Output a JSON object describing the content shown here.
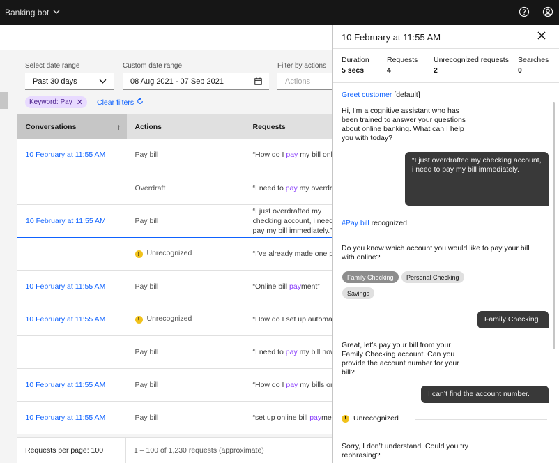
{
  "app": {
    "title": "Banking bot"
  },
  "filters": {
    "date_range_label": "Select date range",
    "date_range_value": "Past 30 days",
    "custom_range_label": "Custom date range",
    "custom_range_value": "08 Aug 2021 - 07 Sep 2021",
    "actions_label": "Filter by actions",
    "actions_placeholder": "Actions",
    "keyword_tag": "Keyword: Pay",
    "clear_filters": "Clear filters"
  },
  "table": {
    "columns": [
      "Conversations",
      "Actions",
      "Requests"
    ],
    "rows": [
      {
        "conversation": "10 February at 11:55 AM",
        "action": "Pay bill",
        "warn": false,
        "req_pre": "“How do I ",
        "req_kw": "pay",
        "req_post": " my bill online?”"
      },
      {
        "conversation": "",
        "action": "Overdraft",
        "warn": false,
        "req_pre": "“I need to ",
        "req_kw": "pay",
        "req_post": " my overdraft fee”"
      },
      {
        "conversation": "10 February at 11:55 AM",
        "action": "Pay bill",
        "warn": false,
        "req_pre": "“I just overdrafted my checking account, i need to pay my bill immediately.”",
        "req_kw": "",
        "req_post": ""
      },
      {
        "conversation": "",
        "action": "Unrecognized",
        "warn": true,
        "req_pre": "“I’ve already made one payment”",
        "req_kw": "",
        "req_post": ""
      },
      {
        "conversation": "10 February at 11:55 AM",
        "action": "Pay bill",
        "warn": false,
        "req_pre": "“Online bill ",
        "req_kw": "pay",
        "req_post": "ment”"
      },
      {
        "conversation": "10 February at 11:55 AM",
        "action": "Unrecognized",
        "warn": true,
        "req_pre": "“How do I set up automatic payments”",
        "req_kw": "",
        "req_post": ""
      },
      {
        "conversation": "",
        "action": "Pay bill",
        "warn": false,
        "req_pre": "“I need to ",
        "req_kw": "pay",
        "req_post": " my bill now”"
      },
      {
        "conversation": "10 February at 11:55 AM",
        "action": "Pay bill",
        "warn": false,
        "req_pre": "“How do I ",
        "req_kw": "pay",
        "req_post": " my bills online”"
      },
      {
        "conversation": "10 February at 11:55 AM",
        "action": "Pay bill",
        "warn": false,
        "req_pre": "“set up online bill ",
        "req_kw": "pay",
        "req_post": "ment”"
      }
    ]
  },
  "footer": {
    "per_page": "Requests per page:  100",
    "range": "1 – 100 of 1,230 requests (approximate)"
  },
  "panel": {
    "title": "10 February at 11:55 AM",
    "stats": [
      {
        "label": "Duration",
        "value": "5 secs"
      },
      {
        "label": "Requests",
        "value": "4"
      },
      {
        "label": "Unrecognized requests",
        "value": "2"
      },
      {
        "label": "Searches",
        "value": "0"
      }
    ],
    "greet_link": "Greet customer",
    "greet_suffix": " [default]",
    "bot_msg_1": "Hi, I'm a cognitive assistant who has been trained to answer your questions about online banking. What can I help you with today?",
    "user_msg_1": "“I just overdrafted my checking account, i need to pay my bill immediately.",
    "intent_link": "#Pay bill",
    "intent_suffix": " recognized",
    "bot_msg_2": "Do you know which account you would like to pay your bill with online?",
    "options": [
      "Family Checking",
      "Personal Checking",
      "Savings"
    ],
    "user_msg_2": "Family Checking",
    "bot_msg_3": "Great, let’s pay your bill from your Family Checking account. Can you provide the account number for your bill?",
    "user_msg_3": "I can’t find the account number.",
    "unrecognized": "Unrecognized",
    "bot_msg_4": "Sorry, I don’t understand. Could you try rephrasing?"
  },
  "colors": {
    "link": "#0f62fe",
    "keyword": "#8a3ffc",
    "warning": "#f1c21b",
    "topbar": "#161616"
  }
}
